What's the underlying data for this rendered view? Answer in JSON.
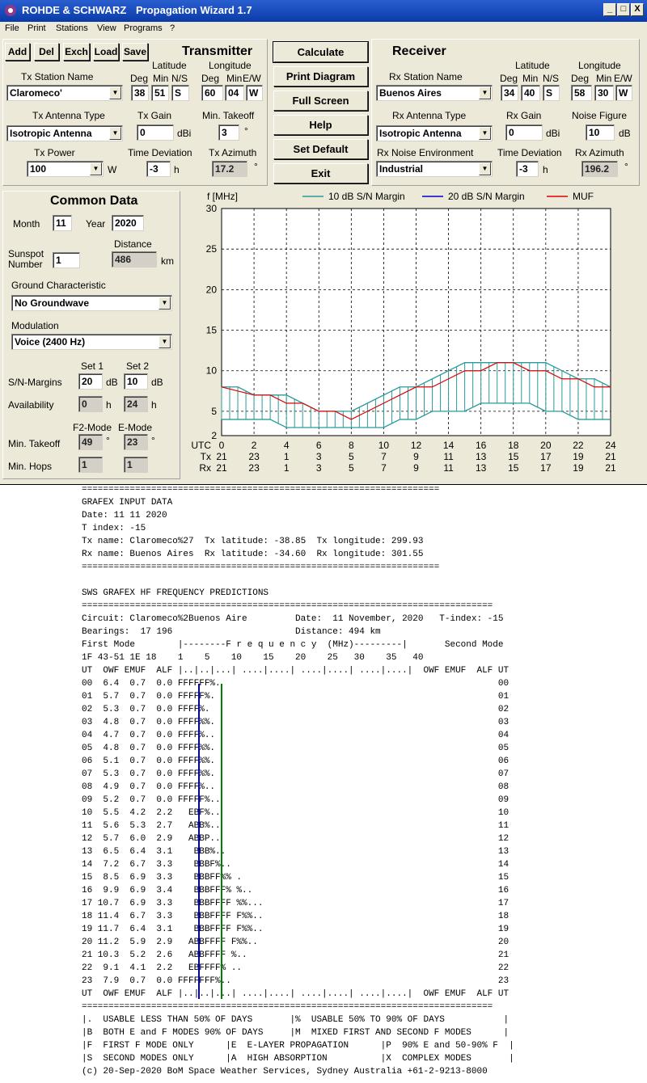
{
  "window": {
    "title_vendor": "ROHDE & SCHWARZ",
    "title_app": "Propagation Wizard  1.7",
    "min": "_",
    "max": "□",
    "close": "X",
    "menu": [
      "File",
      "Print",
      "Stations",
      "View",
      "Programs",
      "?"
    ]
  },
  "toolbar": {
    "add": "Add",
    "del": "Del",
    "exch": "Exch",
    "load": "Load",
    "save": "Save"
  },
  "actions": {
    "calculate": "Calculate",
    "print_diagram": "Print Diagram",
    "full_screen": "Full Screen",
    "help": "Help",
    "set_default": "Set Default",
    "exit": "Exit"
  },
  "transmitter": {
    "heading": "Transmitter",
    "station_label": "Tx Station Name",
    "station": "Claromeco'",
    "lat_label": "Latitude",
    "lon_label": "Longitude",
    "deg": "Deg",
    "min": "Min",
    "ns": "N/S",
    "ew": "E/W",
    "lat_deg": "38",
    "lat_min": "51",
    "lat_ns": "S",
    "lon_deg": "60",
    "lon_min": "04",
    "lon_ew": "W",
    "antenna_label": "Tx Antenna Type",
    "antenna": "Isotropic Antenna",
    "gain_label": "Tx Gain",
    "gain": "0",
    "gain_unit": "dBi",
    "takeoff_label": "Min. Takeoff",
    "takeoff": "3",
    "deg_sym": "°",
    "power_label": "Tx Power",
    "power": "100",
    "power_unit": "W",
    "timedev_label": "Time Deviation",
    "timedev": "-3",
    "h": "h",
    "azimuth_label": "Tx Azimuth",
    "azimuth": "17.2"
  },
  "receiver": {
    "heading": "Receiver",
    "station_label": "Rx Station Name",
    "station": "Buenos Aires",
    "lat_deg": "34",
    "lat_min": "40",
    "lat_ns": "S",
    "lon_deg": "58",
    "lon_min": "30",
    "lon_ew": "W",
    "antenna_label": "Rx Antenna Type",
    "antenna": "Isotropic Antenna",
    "gain_label": "Rx Gain",
    "gain": "0",
    "gain_unit": "dBi",
    "nf_label": "Noise Figure",
    "nf": "10",
    "nf_unit": "dB",
    "noise_env_label": "Rx Noise Environment",
    "noise_env": "Industrial",
    "timedev": "-3",
    "azimuth_label": "Rx Azimuth",
    "azimuth": "196.2"
  },
  "common": {
    "heading": "Common Data",
    "month_label": "Month",
    "month": "11",
    "year_label": "Year",
    "year": "2020",
    "distance_label": "Distance",
    "distance": "486",
    "km": "km",
    "sunspot_label1": "Sunspot",
    "sunspot_label2": "Number",
    "sunspot": "1",
    "ground_label": "Ground Characteristic",
    "ground": "No Groundwave",
    "modulation_label": "Modulation",
    "modulation": "Voice   (2400 Hz)",
    "set1": "Set 1",
    "set2": "Set 2",
    "sn_label": "S/N-Margins",
    "sn1": "20",
    "sn2": "10",
    "db": "dB",
    "avail_label": "Availability",
    "avail1": "0",
    "avail2": "24",
    "f2mode": "F2-Mode",
    "emode": "E-Mode",
    "takeoff_label": "Min. Takeoff",
    "takeoff_f2": "49",
    "takeoff_e": "23",
    "hops_label": "Min. Hops",
    "hops_f2": "1",
    "hops_e": "1"
  },
  "chart_data": {
    "type": "area",
    "ylabel": "f [MHz]",
    "ylim": [
      2,
      30
    ],
    "xlim": [
      0,
      24
    ],
    "yticks": [
      2,
      5,
      10,
      15,
      20,
      25,
      30
    ],
    "xticks": [
      0,
      2,
      4,
      6,
      8,
      10,
      12,
      14,
      16,
      18,
      20,
      22,
      24
    ],
    "row_labels": [
      "UTC",
      "Tx",
      "Rx"
    ],
    "tx_hours": [
      "21",
      "23",
      "1",
      "3",
      "5",
      "7",
      "9",
      "11",
      "13",
      "15",
      "17",
      "19",
      "21"
    ],
    "rx_hours": [
      "21",
      "23",
      "1",
      "3",
      "5",
      "7",
      "9",
      "11",
      "13",
      "15",
      "17",
      "19",
      "21"
    ],
    "hours": [
      0,
      1,
      2,
      3,
      4,
      5,
      6,
      7,
      8,
      9,
      10,
      11,
      12,
      13,
      14,
      15,
      16,
      17,
      18,
      19,
      20,
      21,
      22,
      23,
      24
    ],
    "legend": [
      "10 dB S/N Margin",
      "20 dB S/N Margin",
      "MUF"
    ],
    "colors": {
      "band": "#2a9a9a",
      "margin20": "#0000cc",
      "muf": "#e00000"
    },
    "series": [
      {
        "name": "MUF",
        "values": [
          8,
          7.5,
          7,
          7,
          6,
          6,
          5,
          5,
          4,
          5,
          6,
          7,
          8,
          8,
          9,
          10,
          10,
          11,
          11,
          10,
          10,
          9,
          9,
          8,
          8
        ]
      },
      {
        "name": "10 dB S/N Margin",
        "upper": [
          8,
          8,
          7,
          7,
          7,
          6,
          5,
          5,
          5,
          6,
          7,
          8,
          8,
          9,
          10,
          11,
          11,
          11,
          11,
          11,
          11,
          10,
          9,
          9,
          8
        ],
        "lower": [
          4,
          4,
          4,
          4,
          3,
          3,
          3,
          3,
          3,
          3,
          3,
          4,
          4,
          5,
          5,
          5,
          6,
          6,
          6,
          6,
          5,
          5,
          4,
          4,
          4
        ]
      }
    ]
  },
  "report": {
    "sep": "===================================================================",
    "l1": "GRAFEX INPUT DATA",
    "l2": "Date: 11 11 2020",
    "l3": "T index: -15",
    "l4": "Tx name: Claromeco%27  Tx latitude: -38.85  Tx longitude: 299.93",
    "l5": "Rx name: Buenos Aires  Rx latitude: -34.60  Rx longitude: 301.55",
    "sep2": "===================================================================",
    "l6": "SWS GRAFEX HF FREQUENCY PREDICTIONS",
    "sep3": "=============================================================================",
    "l7": "Circuit: Claromeco%2Buenos Aire         Date:  11 November, 2020   T-index: -15",
    "l8": "Bearings:  17 196                       Distance: 494 km",
    "l9": "First Mode        |--------F r e q u e n c y  (MHz)---------|       Second Mode",
    "l10": "1F 43-51 1E 18    1    5    10    15    20    25   30    35   40",
    "l11": "UT  OWF EMUF  ALF |..|..|...| ....|....| ....|....| ....|....|  OWF EMUF  ALF UT",
    "rows": [
      "00  6.4  0.7  0.0 FFFFFF%.                                                    00",
      "01  5.7  0.7  0.0 FFFFF%.                                                     01",
      "02  5.3  0.7  0.0 FFFF%.                                                      02",
      "03  4.8  0.7  0.0 FFFF%%.                                                     03",
      "04  4.7  0.7  0.0 FFFF%..                                                     04",
      "05  4.8  0.7  0.0 FFFF%%.                                                     05",
      "06  5.1  0.7  0.0 FFFF%%.                                                     06",
      "07  5.3  0.7  0.0 FFFF%%.                                                     07",
      "08  4.9  0.7  0.0 FFFF%..                                                     08",
      "09  5.2  0.7  0.0 FFFFF%..                                                    09",
      "10  5.5  4.2  2.2   EBF%..                                                    10",
      "11  5.6  5.3  2.7   ABB%..                                                    11",
      "12  5.7  6.0  2.9   ABBP..                                                    12",
      "13  6.5  6.4  3.1    BBB%..                                                   13",
      "14  7.2  6.7  3.3    BBBF%..                                                  14",
      "15  8.5  6.9  3.3    BBBFF%% .                                                15",
      "16  9.9  6.9  3.4    BBBFFF% %..                                              16",
      "17 10.7  6.9  3.3    BBBFFFF %%...                                            17",
      "18 11.4  6.7  3.3    BBBFFFF F%%..                                            18",
      "19 11.7  6.4  3.1    BBBFFFF F%%..                                            19",
      "20 11.2  5.9  2.9   ABBFFFF F%%..                                             20",
      "21 10.3  5.2  2.6   ABBFFFF %..                                               21",
      "22  9.1  4.1  2.2   EBFFFF% ..                                                22",
      "23  7.9  0.7  0.0 FFFFFFF%..                                                  23"
    ],
    "l12": "UT  OWF EMUF  ALF |..|..|...| ....|....| ....|....| ....|....|  OWF EMUF  ALF UT",
    "sep4": "=============================================================================",
    "k1": "|.  USABLE LESS THAN 50% OF DAYS       |%  USABLE 50% TO 90% OF DAYS           |",
    "k2": "|B  BOTH E and F MODES 90% OF DAYS     |M  MIXED FIRST AND SECOND F MODES      |",
    "k3": "|F  FIRST F MODE ONLY      |E  E-LAYER PROPAGATION      |P  90% E and 50-90% F  |",
    "k4": "|S  SECOND MODES ONLY      |A  HIGH ABSORPTION          |X  COMPLEX MODES       |",
    "k5": "(c) 20-Sep-2020 BoM Space Weather Services, Sydney Australia +61-2-9213-8000"
  }
}
